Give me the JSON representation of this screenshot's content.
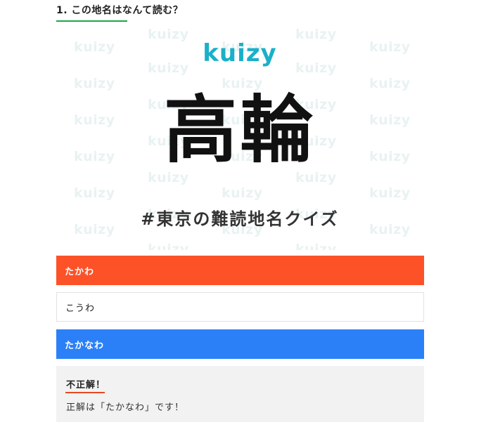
{
  "question": {
    "heading": "1. この地名はなんて読む？"
  },
  "quiz_image": {
    "logo": "kuizy",
    "place_name": "高輪",
    "hashtag": "#東京の難読地名クイズ",
    "watermark": "kuizy"
  },
  "choices": [
    {
      "label": "たかわ",
      "state": "wrong",
      "color": "#fd5128"
    },
    {
      "label": "こうわ",
      "state": "neutral",
      "color": "#ffffff"
    },
    {
      "label": "たかなわ",
      "state": "correct",
      "color": "#2b80f8"
    }
  ],
  "result": {
    "title": "不正解！",
    "message": "正解は「たかなわ」です！"
  }
}
